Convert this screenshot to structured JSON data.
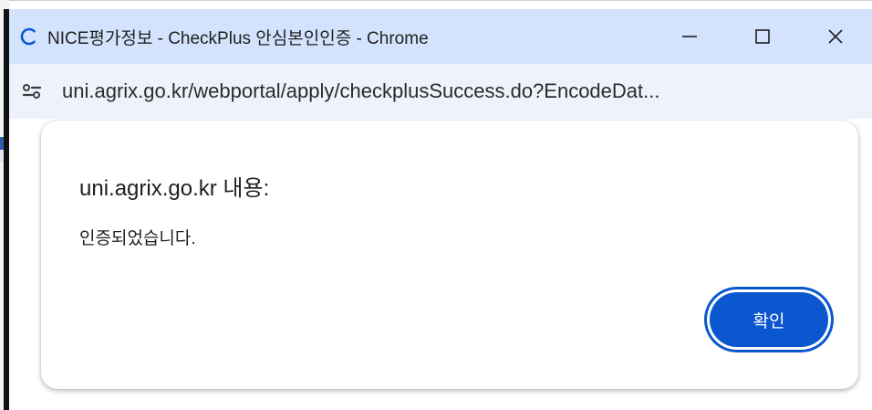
{
  "window": {
    "title": "NICE평가정보 - CheckPlus 안심본인인증 - Chrome",
    "minimize_label": "—",
    "maximize_label": "☐",
    "close_label": "✕"
  },
  "address_bar": {
    "url": "uni.agrix.go.kr/webportal/apply/checkplusSuccess.do?EncodeDat..."
  },
  "dialog": {
    "title": "uni.agrix.go.kr 내용:",
    "message": "인증되었습니다.",
    "ok_label": "확인"
  },
  "colors": {
    "titlebar_bg": "#d3e3fd",
    "urlbar_bg": "#eef3fb",
    "button_bg": "#0b57d0"
  },
  "icons": {
    "title": "loading-spinner-icon",
    "site_info": "site-info-tune-icon"
  }
}
